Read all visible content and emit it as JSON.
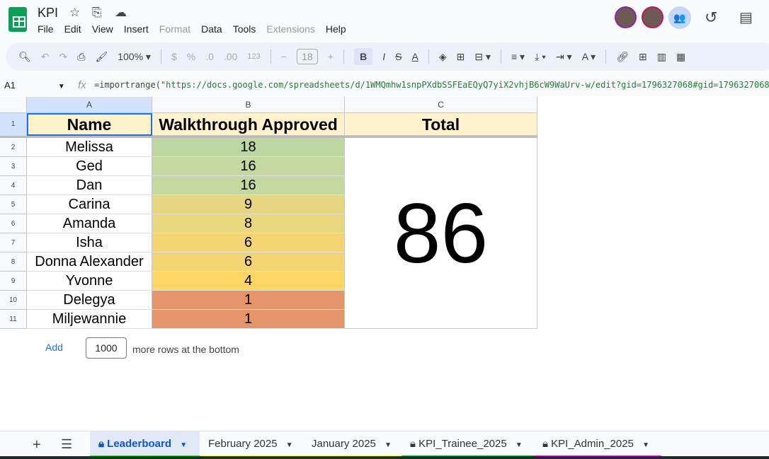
{
  "app": {
    "title": "KPI",
    "menu": [
      "File",
      "Edit",
      "View",
      "Insert",
      "Format",
      "Data",
      "Tools",
      "Extensions",
      "Help"
    ],
    "disabled_menu": [
      "Format",
      "Extensions"
    ]
  },
  "toolbar": {
    "zoom": "100%",
    "font_size": "18",
    "currency": "$",
    "percent": "%",
    "dec_dec": ".0",
    "dec_inc": ".00",
    "num_format": "123"
  },
  "formula_bar": {
    "cell_ref": "A1",
    "fx": "fx",
    "formula_fn": "=importrange(",
    "formula_arg": "\"https://docs.google.com/spreadsheets/d/1WMQmhw1snpPXdbSSFEaEQyQ7yiX2vhjB6cW9WaUrv-w/edit?gid=1796327068#gid=1796327068\""
  },
  "sheet": {
    "columns": [
      "A",
      "B",
      "C"
    ],
    "headers": [
      "Name",
      "Walkthrough Approved",
      "Total"
    ],
    "rows": [
      {
        "num": "2",
        "name": "Melissa",
        "value": "18",
        "color": "#bcd7a2"
      },
      {
        "num": "3",
        "name": "Ged",
        "value": "16",
        "color": "#c4d89f"
      },
      {
        "num": "4",
        "name": "Dan",
        "value": "16",
        "color": "#c4d89f"
      },
      {
        "num": "5",
        "name": "Carina",
        "value": "9",
        "color": "#e6d581"
      },
      {
        "num": "6",
        "name": "Amanda",
        "value": "8",
        "color": "#ead67c"
      },
      {
        "num": "7",
        "name": "Isha",
        "value": "6",
        "color": "#f4d571"
      },
      {
        "num": "8",
        "name": "Donna Alexander",
        "value": "6",
        "color": "#f4d571"
      },
      {
        "num": "9",
        "name": "Yvonne",
        "value": "4",
        "color": "#fdd666"
      },
      {
        "num": "10",
        "name": "Delegya",
        "value": "1",
        "color": "#e6946a"
      },
      {
        "num": "11",
        "name": "Miljewannie",
        "value": "1",
        "color": "#e6946a"
      }
    ],
    "total": "86",
    "header_color": "#fff2cc"
  },
  "add_rows": {
    "button": "Add",
    "count": "1000",
    "text": "more rows at the bottom"
  },
  "tabs": [
    {
      "label": "Leaderboard",
      "locked": true,
      "active": true,
      "color": "#22dd22"
    },
    {
      "label": "February 2025",
      "locked": false,
      "color": "#ffff22"
    },
    {
      "label": "January 2025",
      "locked": false,
      "color": "#ffff22"
    },
    {
      "label": "KPI_Trainee_2025",
      "locked": true,
      "color": "#1eb84a"
    },
    {
      "label": "KPI_Admin_2025",
      "locked": true,
      "color": "#e020e0"
    }
  ]
}
